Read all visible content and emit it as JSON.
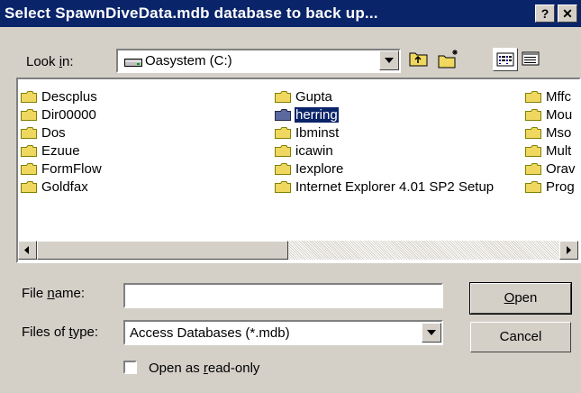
{
  "window": {
    "title": "Select SpawnDiveData.mdb database to back up...",
    "help_label": "?",
    "close_label": "✕"
  },
  "look_in": {
    "label_pre": "Look ",
    "label_u": "i",
    "label_post": "n:",
    "value": "Oasystem (C:)"
  },
  "toolbar": {
    "up_icon": "up-one-level-icon",
    "new_folder_icon": "new-folder-icon",
    "list_icon": "list-view-icon",
    "details_icon": "details-view-icon"
  },
  "files": {
    "col1": [
      "Descplus",
      "Dir00000",
      "Dos",
      "Ezuue",
      "FormFlow",
      "Goldfax"
    ],
    "col2": [
      "Gupta",
      "herring",
      "Ibminst",
      "icawin",
      "Iexplore",
      "Internet Explorer 4.01 SP2 Setup"
    ],
    "col3": [
      "Mffc",
      "Mou",
      "Mso",
      "Mult",
      "Orav",
      "Prog"
    ],
    "selected": "herring"
  },
  "filename": {
    "label_pre": "File ",
    "label_u": "n",
    "label_post": "ame:",
    "value": ""
  },
  "filetype": {
    "label_pre": "Files of ",
    "label_u": "t",
    "label_post": "ype:",
    "value": "Access Databases (*.mdb)"
  },
  "readonly": {
    "label_pre": "Open as ",
    "label_u": "r",
    "label_post": "ead-only",
    "checked": false
  },
  "buttons": {
    "open_u": "O",
    "open_rest": "pen",
    "cancel": "Cancel"
  },
  "colors": {
    "titlebar": "#0a246a",
    "face": "#d4d0c8",
    "folder": "#f0d860",
    "folder_selected": "#5a6aa0"
  }
}
